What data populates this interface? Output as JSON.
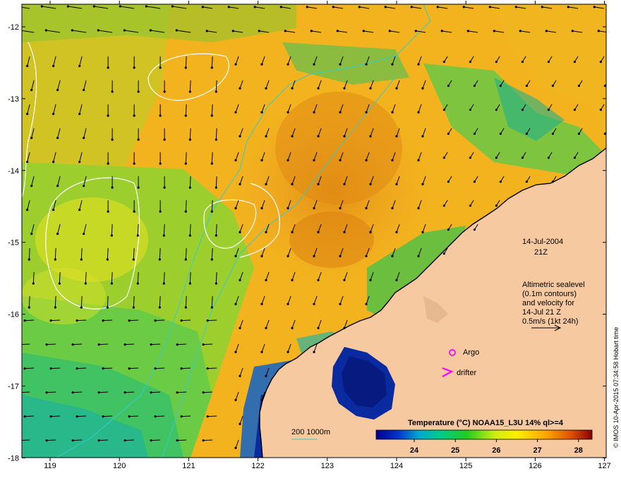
{
  "map": {
    "lat_labels": [
      "-12",
      "-13",
      "-14",
      "-15",
      "-16",
      "-17",
      "-18"
    ],
    "lon_labels": [
      "119",
      "120",
      "121",
      "122",
      "123",
      "124",
      "125",
      "126",
      "127"
    ],
    "date_text": "14-Jul-2004",
    "time_text": "21Z",
    "info_lines": [
      "Altimetric sealevel",
      "(0.1m contours)",
      "and velocity for",
      "14-Jul 21 Z",
      "0.5m/s (1kt 24h)"
    ],
    "argo_label": "Argo",
    "drifter_label": "drifter",
    "isobath_label": "200 1000m",
    "colorbar_title": "Temperature (°C) NOAA15_L3U 14% ql>=4",
    "colorbar_ticks": [
      "24",
      "25",
      "26",
      "27",
      "28"
    ],
    "copyright": "© IMOS 10-Apr-2015 07:34:58 Hobart time",
    "colors": {
      "land": "#f7c9a0",
      "arrow": "#000000",
      "contour": "#ffffff",
      "isobath": "#33cccc",
      "marker": "#ff00ff"
    }
  }
}
